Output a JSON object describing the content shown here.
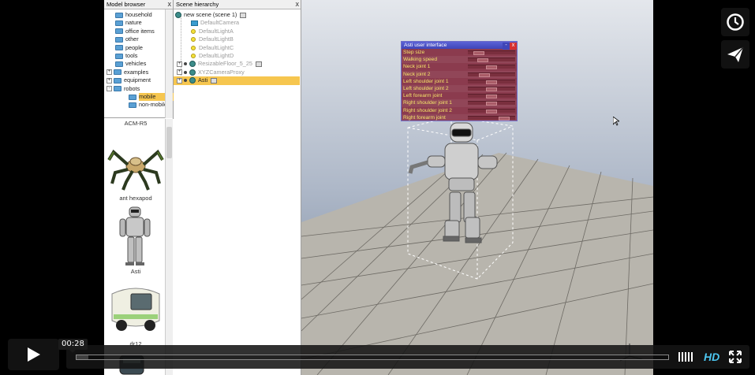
{
  "player": {
    "current_time": "00:28",
    "progress_fraction": 0.0,
    "hd_label": "HD",
    "accent_color": "#4cc5ef"
  },
  "side_buttons": [
    {
      "icon": "clock-icon"
    },
    {
      "icon": "send-icon"
    }
  ],
  "model_browser": {
    "title": "Model browser",
    "close": "x",
    "tree": [
      {
        "label": "household",
        "indent": 0,
        "expander": ""
      },
      {
        "label": "nature",
        "indent": 0,
        "expander": ""
      },
      {
        "label": "office items",
        "indent": 0,
        "expander": ""
      },
      {
        "label": "other",
        "indent": 0,
        "expander": ""
      },
      {
        "label": "people",
        "indent": 0,
        "expander": ""
      },
      {
        "label": "tools",
        "indent": 0,
        "expander": ""
      },
      {
        "label": "vehicles",
        "indent": 0,
        "expander": ""
      },
      {
        "label": "examples",
        "indent": 0,
        "expander": "+"
      },
      {
        "label": "equipment",
        "indent": 0,
        "expander": "+"
      },
      {
        "label": "robots",
        "indent": 0,
        "expander": "-"
      },
      {
        "label": "mobile",
        "indent": 1,
        "expander": "",
        "selected": true
      },
      {
        "label": "non-mobile",
        "indent": 1,
        "expander": ""
      }
    ],
    "thumbnails": [
      {
        "label": "ACM-R5"
      },
      {
        "label": "ant hexapod"
      },
      {
        "label": "Asti"
      },
      {
        "label": "dr12"
      }
    ]
  },
  "scene_hierarchy": {
    "title": "Scene hierarchy",
    "close": "x",
    "items": [
      {
        "label": "new scene (scene 1)",
        "type": "root"
      },
      {
        "label": "DefaultCamera",
        "type": "camera",
        "dim": true
      },
      {
        "label": "DefaultLightA",
        "type": "light",
        "dim": true
      },
      {
        "label": "DefaultLightB",
        "type": "light",
        "dim": true
      },
      {
        "label": "DefaultLightC",
        "type": "light",
        "dim": true
      },
      {
        "label": "DefaultLightD",
        "type": "light",
        "dim": true
      },
      {
        "label": "ResizableFloor_5_25",
        "type": "object",
        "dim": true
      },
      {
        "label": "XYZCameraProxy",
        "type": "object",
        "dim": true
      },
      {
        "label": "Asti",
        "type": "object",
        "selected": true
      }
    ]
  },
  "asti_ui": {
    "title": "Asti user interface",
    "min": "-",
    "close": "x",
    "rows": [
      {
        "label": "Step size",
        "value": 0.15
      },
      {
        "label": "Walking speed",
        "value": 0.25
      },
      {
        "label": "Neck joint 1",
        "value": 0.5
      },
      {
        "label": "Neck joint 2",
        "value": 0.3
      },
      {
        "label": "Left shoulder joint 1",
        "value": 0.5
      },
      {
        "label": "Left shoulder joint 2",
        "value": 0.5
      },
      {
        "label": "Left forearm joint",
        "value": 0.5
      },
      {
        "label": "Right shoulder joint 1",
        "value": 0.5
      },
      {
        "label": "Right shoulder joint 2",
        "value": 0.5
      },
      {
        "label": "Right forearm joint",
        "value": 0.85
      }
    ]
  }
}
